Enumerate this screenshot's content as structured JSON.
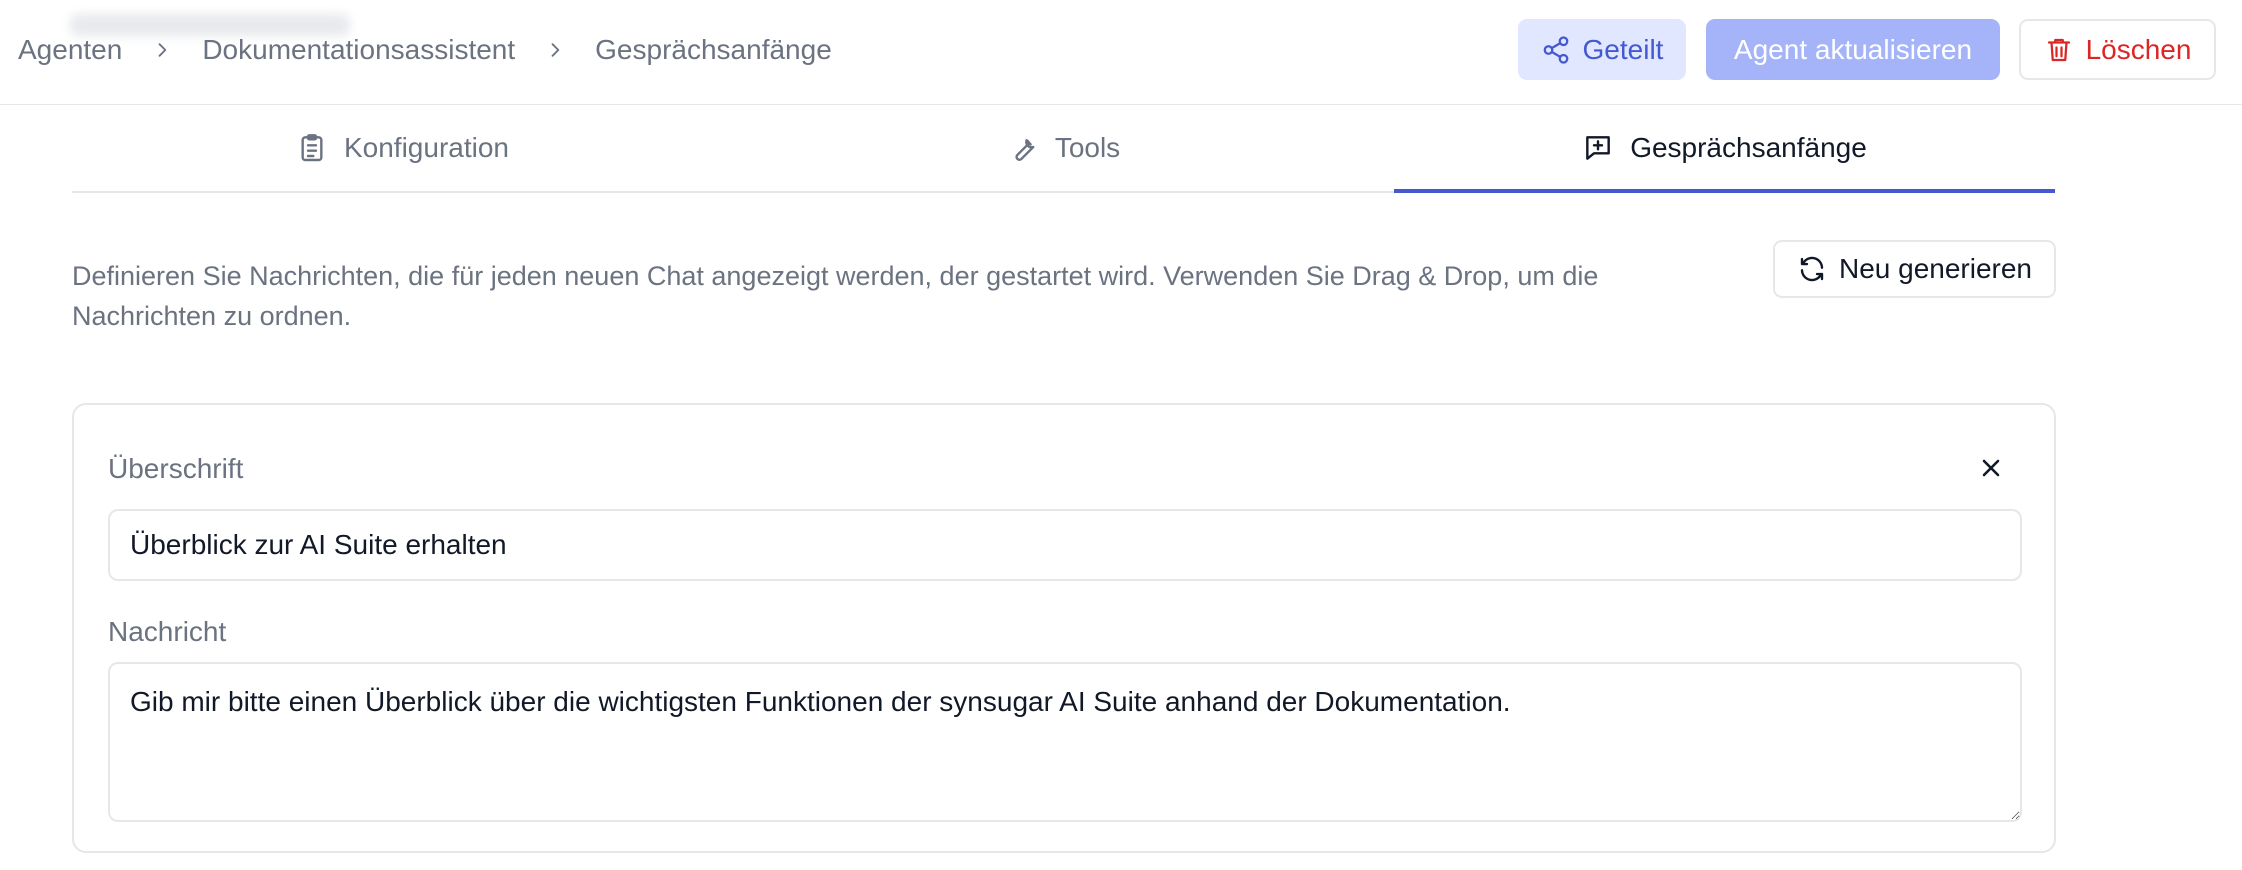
{
  "breadcrumb": {
    "items": [
      "Agenten",
      "Dokumentationsassistent",
      "Gesprächsanfänge"
    ]
  },
  "header_actions": {
    "shared_label": "Geteilt",
    "update_label": "Agent aktualisieren",
    "delete_label": "Löschen"
  },
  "tabs": [
    {
      "label": "Konfiguration",
      "icon": "clipboard-icon",
      "active": false
    },
    {
      "label": "Tools",
      "icon": "wrench-icon",
      "active": false
    },
    {
      "label": "Gesprächsanfänge",
      "icon": "message-plus-icon",
      "active": true
    }
  ],
  "conversation_starters": {
    "description": "Definieren Sie Nachrichten, die für jeden neuen Chat angezeigt werden, der gestartet wird. Verwenden Sie Drag & Drop, um die Nachrichten zu ordnen.",
    "regenerate_label": "Neu generieren",
    "starters": [
      {
        "heading_label": "Überschrift",
        "heading_value": "Überblick zur AI Suite erhalten",
        "message_label": "Nachricht",
        "message_value": "Gib mir bitte einen Überblick über die wichtigsten Funktionen der synsugar AI Suite anhand der Dokumentation."
      }
    ]
  },
  "colors": {
    "accent": "#4458d1",
    "accent_light": "#e0e7ff",
    "accent_disabled": "#a5b4f8",
    "danger": "#dc2626",
    "muted_text": "#6b7280",
    "border": "#e5e7eb"
  }
}
